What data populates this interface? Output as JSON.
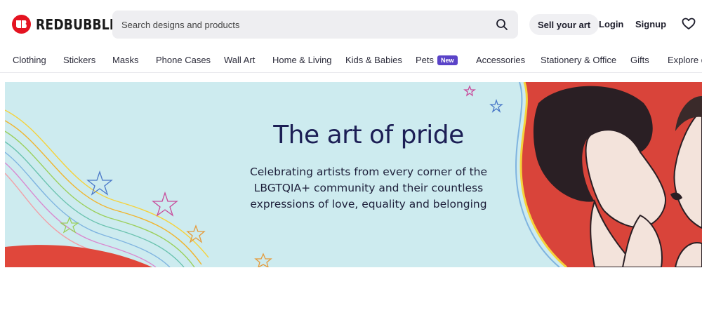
{
  "header": {
    "logo_text": "REDBUBBLE",
    "search_placeholder": "Search designs and products",
    "sell_label": "Sell your art",
    "login_label": "Login",
    "signup_label": "Signup"
  },
  "nav": {
    "categories": [
      "Clothing",
      "Stickers",
      "Masks",
      "Phone Cases",
      "Wall Art",
      "Home & Living",
      "Kids & Babies",
      "Pets",
      "Accessories",
      "Stationery & Office",
      "Gifts",
      "Explore designs"
    ],
    "new_badge": "New"
  },
  "banner": {
    "headline": "The art of pride",
    "subtext": "Celebrating artists from every corner of the LBGTQIA+ community and their countless expressions of love, equality and belonging"
  },
  "colors": {
    "brand_red": "#e41321",
    "banner_bg": "#cdebef",
    "headline": "#1c1f55",
    "badge": "#5a43c8"
  },
  "icons": [
    "logo-icon",
    "search-icon",
    "heart-icon",
    "star-icon"
  ]
}
